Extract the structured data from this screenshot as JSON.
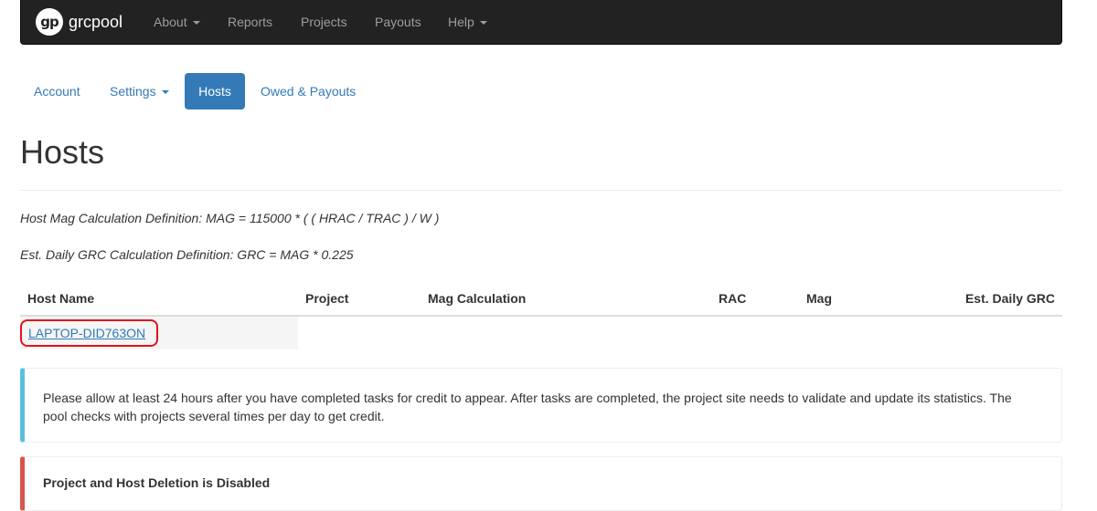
{
  "navbar": {
    "brand_logo": "gp",
    "brand": "grcpool",
    "items": [
      {
        "label": "About",
        "dropdown": true
      },
      {
        "label": "Reports",
        "dropdown": false
      },
      {
        "label": "Projects",
        "dropdown": false
      },
      {
        "label": "Payouts",
        "dropdown": false
      },
      {
        "label": "Help",
        "dropdown": true
      }
    ]
  },
  "tabs": [
    {
      "label": "Account",
      "active": false
    },
    {
      "label": "Settings",
      "active": false,
      "dropdown": true
    },
    {
      "label": "Hosts",
      "active": true
    },
    {
      "label": "Owed & Payouts",
      "active": false
    }
  ],
  "page_title": "Hosts",
  "definitions": {
    "mag": "Host Mag Calculation Definition: MAG = 115000 * ( ( HRAC / TRAC ) / W )",
    "grc": "Est. Daily GRC Calculation Definition: GRC = MAG * 0.225"
  },
  "table": {
    "headers": [
      "Host Name",
      "Project",
      "Mag Calculation",
      "RAC",
      "Mag",
      "Est. Daily GRC"
    ],
    "rows": [
      {
        "host_name": "LAPTOP-DID763ON"
      }
    ]
  },
  "alerts": {
    "info": "Please allow at least 24 hours after you have completed tasks for credit to appear. After tasks are completed, the project site needs to validate and update its statistics. The pool checks with projects several times per day to get credit.",
    "danger_heading": "Project and Host Deletion is Disabled"
  },
  "colors": {
    "navbar_bg": "#222222",
    "link": "#337ab7",
    "info_border": "#5bc0de",
    "danger_border": "#d9534f",
    "highlight": "#e3121a"
  }
}
